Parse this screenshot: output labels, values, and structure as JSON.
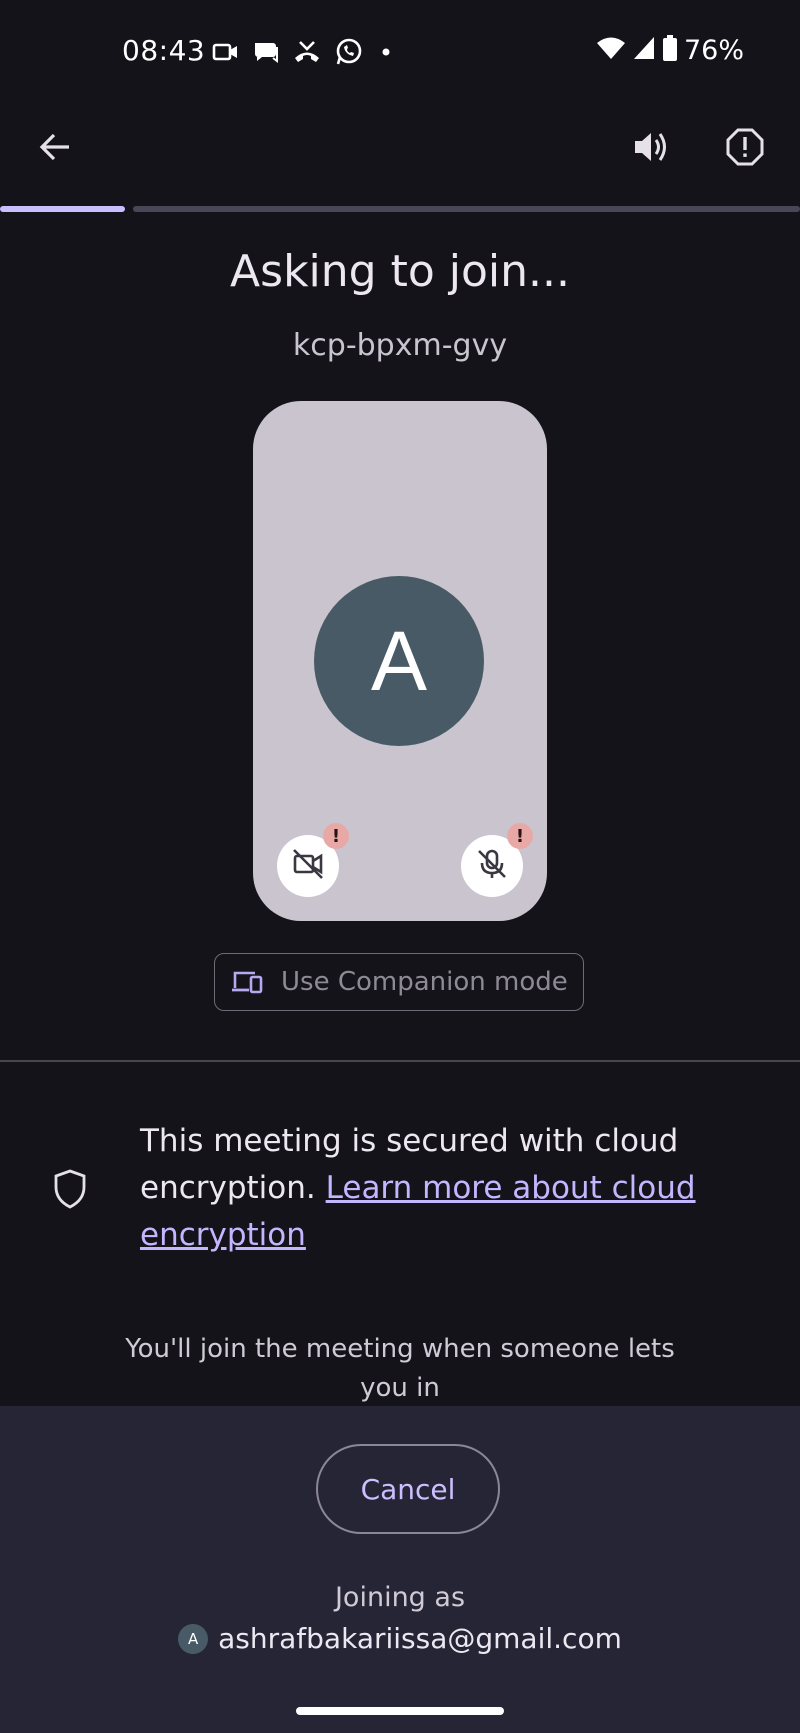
{
  "status_bar": {
    "time": "08:43",
    "notification_icons": [
      "video-call-icon",
      "chat-bubble-icon",
      "missed-call-icon",
      "whatsapp-icon",
      "more-notifications-dot"
    ],
    "battery_percent": "76%"
  },
  "app_bar": {
    "back_icon": "arrow-back-icon",
    "audio_icon": "speaker-icon",
    "report_icon": "report-icon"
  },
  "progress": {
    "fraction": 0.16
  },
  "title": "Asking to join...",
  "meeting_code": "kcp-bpxm-gvy",
  "preview": {
    "avatar_initial": "A",
    "camera_warning": "!",
    "mic_warning": "!"
  },
  "companion_mode": {
    "label": "Use Companion mode"
  },
  "encryption": {
    "text": "This meeting is secured with cloud encryption.",
    "link": "Learn more about cloud encryption"
  },
  "wait_message": "You'll join the meeting when someone lets you in",
  "bottom": {
    "cancel_label": "Cancel",
    "joining_as_label": "Joining as",
    "account_initial": "A",
    "account_email": "ashrafbakariissa@gmail.com"
  },
  "colors": {
    "background": "#14131a",
    "accent": "#c8bfff",
    "preview_bg": "#cac4cf",
    "avatar_bg": "#475a65",
    "warning_badge": "#e8a9a6",
    "bottom_panel": "#262535"
  }
}
